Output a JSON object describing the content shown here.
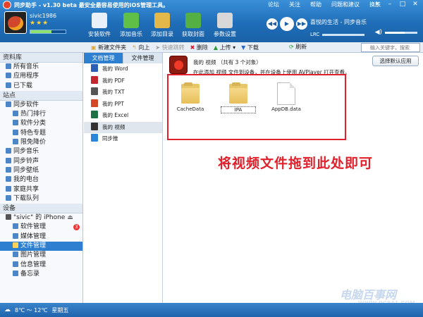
{
  "titlebar": {
    "title": "同步助手 - v1.30 beta  最安全最容易使用的iOS管理工具。",
    "links": [
      "论坛",
      "关注",
      "帮助",
      "问题和建议",
      "换肤"
    ]
  },
  "user": {
    "name": "sivic1986",
    "stars": "★★★",
    "progress": 0.6
  },
  "toolbar_top": [
    {
      "label": "安装软件",
      "color": "#e9f0f8",
      "icon": "install-icon"
    },
    {
      "label": "添加音乐",
      "color": "#5fbf47",
      "icon": "music-add-icon"
    },
    {
      "label": "添加目录",
      "color": "#e3b84a",
      "icon": "folder-add-icon"
    },
    {
      "label": "获取封面",
      "color": "#55b044",
      "icon": "cover-icon"
    },
    {
      "label": "参数设置",
      "color": "#d8d8d8",
      "icon": "settings-icon"
    }
  ],
  "player": {
    "song": "喜悦的生活 - 同步音乐",
    "lrc": "LRC"
  },
  "search": {
    "placeholder": "输入关键字，搜索"
  },
  "sidebar": {
    "library_title": "资料库",
    "library": [
      "所有音乐",
      "应用程序",
      "已下载"
    ],
    "sites_title": "站点",
    "sites": [
      "同步软件",
      "热门排行",
      "软件分类",
      "特色专题",
      "限免降价",
      "同步音乐",
      "同步铃声",
      "同步壁纸",
      "我的电台",
      "家庭共享",
      "下载队列"
    ],
    "device_title": "设备",
    "device_name": "\"sivic\" 的 iPhone",
    "device_items": [
      "软件管理",
      "媒体管理",
      "文件管理",
      "图片管理",
      "信息管理",
      "备忘录"
    ],
    "badge": "3"
  },
  "filetoolbar": {
    "new_folder": "新建文件夹",
    "up": "向上",
    "shortcut": "快速跳转",
    "delete": "删除",
    "upload": "上传",
    "download": "下载",
    "refresh": "刷新"
  },
  "tabs": [
    "文档管理",
    "文件管理"
  ],
  "categories": [
    "我的 Word",
    "我的 PDF",
    "我的 TXT",
    "我的 PPT",
    "我的 Excel",
    "我的 视频",
    "同步推"
  ],
  "category_colors": [
    "#2b5fb5",
    "#c1272d",
    "#555555",
    "#d24726",
    "#1e7145",
    "#333333",
    "#2a86d8"
  ],
  "content": {
    "title": "我的 视频 （共有 3 个对象）",
    "hint": "在此添加 视频 文件到设备，并在设备上使用 AVPlayer 打开查看。",
    "restore_button": "选择默认应用",
    "files": [
      "CacheData",
      "IPA",
      "AppDB.data"
    ],
    "instruction": "将视频文件拖到此处即可"
  },
  "watermark": {
    "logo": "电脑百事网",
    "url": "WWW.PC841.COM"
  },
  "status": {
    "temp": "8℃ ～ 12℃",
    "day": "星期五"
  }
}
